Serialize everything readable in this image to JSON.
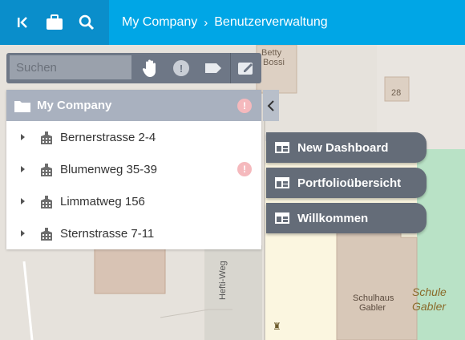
{
  "breadcrumb": {
    "company": "My Company",
    "separator": "›",
    "page": "Benutzerverwaltung"
  },
  "topbar_icons": [
    "collapse-left-icon",
    "briefcase-icon",
    "search-icon"
  ],
  "search": {
    "placeholder": "Suchen",
    "value": ""
  },
  "toolbar_icons": [
    "hand-icon",
    "alert-icon",
    "tag-icon",
    "edit-icon"
  ],
  "tree": {
    "root": "My Company",
    "items": [
      {
        "label": "Bernerstrasse 2-4",
        "alert": false
      },
      {
        "label": "Blumenweg 35-39",
        "alert": true
      },
      {
        "label": "Limmatweg 156",
        "alert": false
      },
      {
        "label": "Sternstrasse 7-11",
        "alert": false
      }
    ]
  },
  "dashboards": [
    "New Dashboard",
    "Portfolioübersicht",
    "Willkommen"
  ],
  "map_labels": {
    "betty": "Betty",
    "bossi": "Bossi",
    "house_no": "28",
    "school": "Schulhaus",
    "school2": "Gabler",
    "school_name": "Schule",
    "school_name2": "Gabler",
    "street": "Hefti-Weg"
  },
  "colors": {
    "topbar": "#00a6e6",
    "topbar_left": "#0a8ecb",
    "dashboard_button": "#646c78"
  }
}
